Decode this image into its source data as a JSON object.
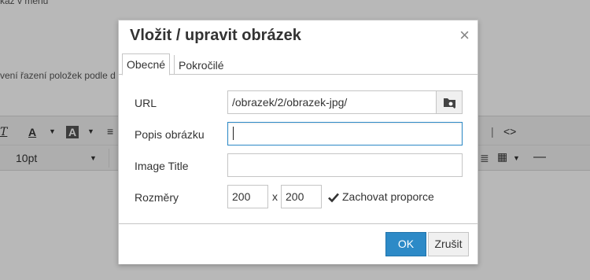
{
  "background": {
    "top_text": "kaz v menu",
    "mid_text": "vení řazení položek podle d",
    "font_size_value": "10pt"
  },
  "dialog": {
    "title": "Vložit / upravit obrázek",
    "close_glyph": "×",
    "tabs": [
      {
        "label": "Obecné",
        "active": true
      },
      {
        "label": "Pokročilé",
        "active": false
      }
    ],
    "fields": {
      "url": {
        "label": "URL",
        "value": "/obrazek/2/obrazek-jpg/"
      },
      "description": {
        "label": "Popis obrázku",
        "value": ""
      },
      "image_title": {
        "label": "Image Title",
        "value": ""
      },
      "dimensions": {
        "label": "Rozměry",
        "width": "200",
        "separator": "x",
        "height": "200"
      },
      "constrain": {
        "label": "Zachovat proporce",
        "checked": true
      }
    },
    "buttons": {
      "ok": "OK",
      "cancel": "Zrušit"
    }
  },
  "colors": {
    "primary": "#2d8ac7",
    "overlay": "#000000"
  }
}
